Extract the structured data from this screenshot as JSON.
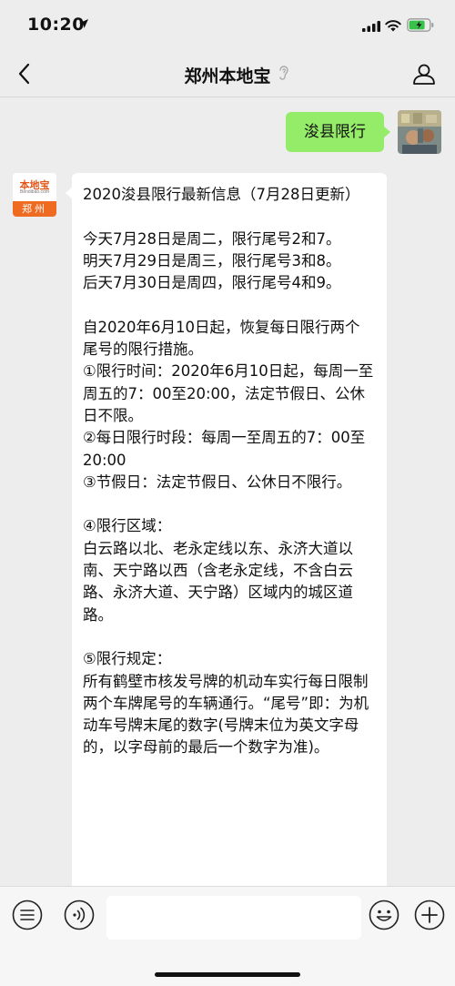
{
  "status": {
    "time": "10:20"
  },
  "nav": {
    "title": "郑州本地宝"
  },
  "chat": {
    "user_message": "浚县限行",
    "bot_avatar": {
      "logo_text": "本地宝",
      "sub_text": "Bendibao.com",
      "city": "郑州"
    },
    "bot_message": "2020浚县限行最新信息（7月28日更新）\n\n今天7月28日是周二，限行尾号2和7。\n明天7月29日是周三，限行尾号3和8。\n后天7月30日是周四，限行尾号4和9。\n\n自2020年6月10日起，恢复每日限行两个尾号的限行措施。\n①限行时间：2020年6月10日起，每周一至周五的7：00至20:00，法定节假日、公休日不限。\n②每日限行时段：每周一至周五的7：00至20:00\n③节假日：法定节假日、公休日不限行。\n\n④限行区域：\n白云路以北、老永定线以东、永济大道以南、天宁路以西（含老永定线，不含白云路、永济大道、天宁路）区域内的城区道路。\n\n⑤限行规定：\n所有鹤壁市核发号牌的机动车实行每日限制两个车牌尾号的车辆通行。“尾号”即：为机动车号牌末尾的数字(号牌末位为英文字母的，以字母前的最后一个数字为准)。"
  },
  "colors": {
    "user_bubble": "#95ec69",
    "brand_orange": "#ef6b22"
  }
}
